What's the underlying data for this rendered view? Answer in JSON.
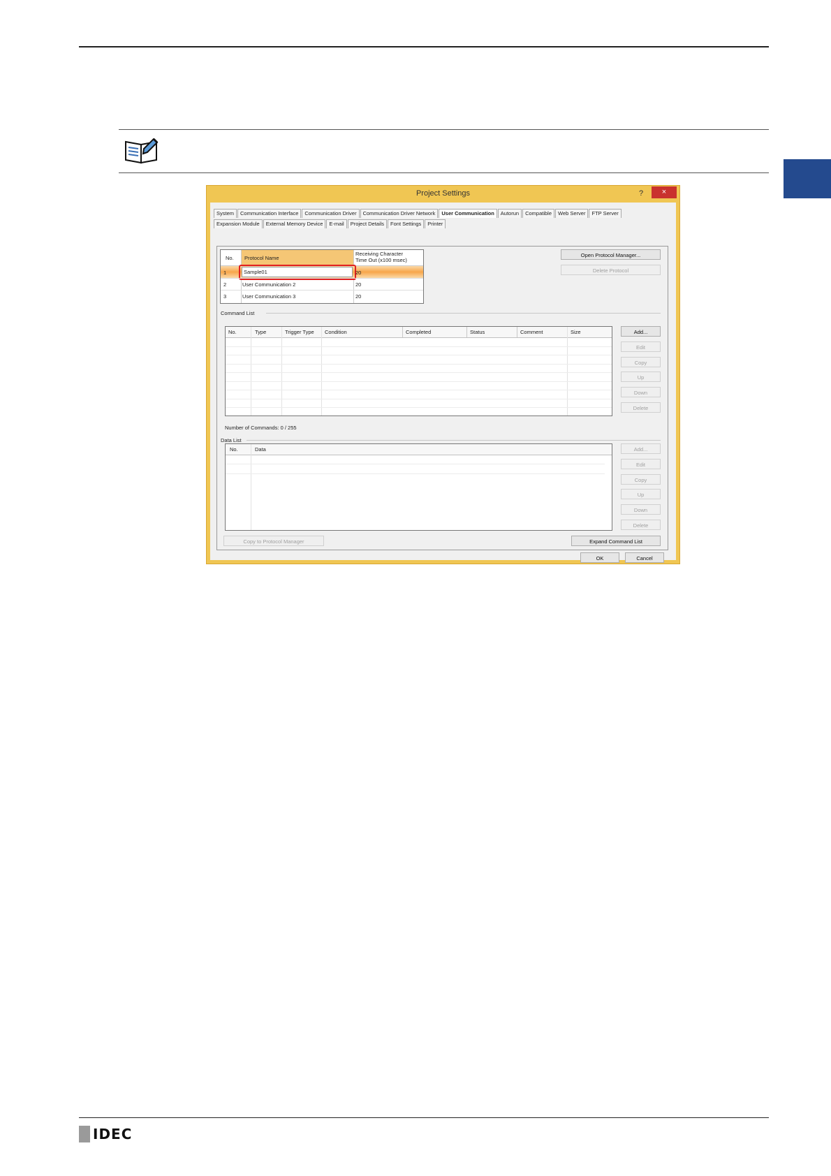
{
  "dialog": {
    "title": "Project Settings",
    "help_label": "?",
    "close_label": "×",
    "tabs_row1": [
      "System",
      "Communication Interface",
      "Communication Driver",
      "Communication Driver Network",
      "User Communication",
      "Autorun",
      "Compatible",
      "Web Server",
      "FTP Server"
    ],
    "tabs_row2": [
      "Expansion Module",
      "External Memory Device",
      "E-mail",
      "Project Details",
      "Font Settings",
      "Printer"
    ],
    "active_tab": "User Communication"
  },
  "protocol_table": {
    "headers": [
      "No.",
      "Protocol Name",
      "Receiving Character Time Out (x100 msec)"
    ],
    "header_timeout_line1": "Receiving Character",
    "header_timeout_line2": "Time Out (x100 msec)",
    "rows": [
      {
        "no": "1",
        "name": "Sample01",
        "timeout": "20"
      },
      {
        "no": "2",
        "name": "User Communication 2",
        "timeout": "20"
      },
      {
        "no": "3",
        "name": "User Communication 3",
        "timeout": "20"
      }
    ]
  },
  "protocol_buttons": {
    "open_manager": "Open Protocol Manager...",
    "delete_protocol": "Delete Protocol"
  },
  "command_list": {
    "label": "Command List",
    "headers": [
      "No.",
      "Type",
      "Trigger Type",
      "Condition",
      "Completed",
      "Status",
      "Comment",
      "Size"
    ],
    "buttons": [
      "Add...",
      "Edit",
      "Copy",
      "Up",
      "Down",
      "Delete"
    ],
    "count_text": "Number of Commands: 0 / 255"
  },
  "data_list": {
    "label": "Data List",
    "headers": [
      "No.",
      "Data"
    ],
    "buttons": [
      "Add...",
      "Edit",
      "Copy",
      "Up",
      "Down",
      "Delete"
    ]
  },
  "bottom_buttons": {
    "copy_to_manager": "Copy to Protocol Manager",
    "expand_command_list": "Expand Command List",
    "ok": "OK",
    "cancel": "Cancel"
  },
  "footer": {
    "logo": "IDEC"
  },
  "colors": {
    "side_tab": "#244a8e",
    "dialog_frame": "#f0c653",
    "selected_row": "#f7a64a",
    "highlight_box": "#e02020"
  }
}
